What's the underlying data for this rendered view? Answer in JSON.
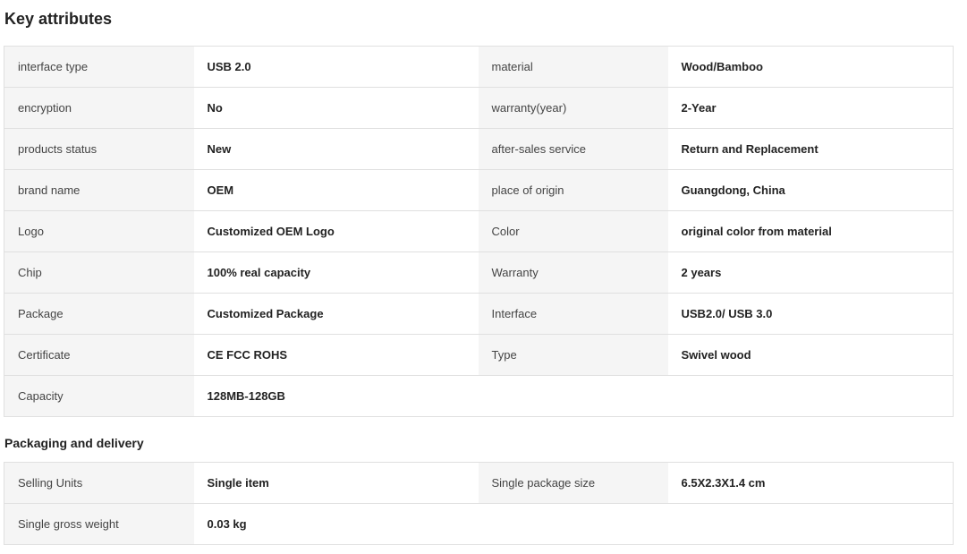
{
  "key_attributes": {
    "title": "Key attributes",
    "rows": [
      [
        {
          "k": "interface type",
          "v": "USB 2.0"
        },
        {
          "k": "material",
          "v": "Wood/Bamboo"
        }
      ],
      [
        {
          "k": "encryption",
          "v": "No"
        },
        {
          "k": "warranty(year)",
          "v": "2-Year"
        }
      ],
      [
        {
          "k": "products status",
          "v": "New"
        },
        {
          "k": "after-sales service",
          "v": "Return and Replacement"
        }
      ],
      [
        {
          "k": "brand name",
          "v": "OEM"
        },
        {
          "k": "place of origin",
          "v": "Guangdong, China"
        }
      ],
      [
        {
          "k": "Logo",
          "v": "Customized OEM Logo"
        },
        {
          "k": "Color",
          "v": "original color from material"
        }
      ],
      [
        {
          "k": "Chip",
          "v": "100% real capacity"
        },
        {
          "k": "Warranty",
          "v": "2 years"
        }
      ],
      [
        {
          "k": "Package",
          "v": "Customized Package"
        },
        {
          "k": "Interface",
          "v": "USB2.0/ USB 3.0"
        }
      ],
      [
        {
          "k": "Certificate",
          "v": "CE FCC ROHS"
        },
        {
          "k": "Type",
          "v": "Swivel wood"
        }
      ],
      [
        {
          "k": "Capacity",
          "v": "128MB-128GB"
        }
      ]
    ]
  },
  "packaging": {
    "title": "Packaging and delivery",
    "rows": [
      [
        {
          "k": "Selling Units",
          "v": "Single item"
        },
        {
          "k": "Single package size",
          "v": "6.5X2.3X1.4 cm"
        }
      ],
      [
        {
          "k": "Single gross weight",
          "v": "0.03 kg"
        }
      ]
    ]
  }
}
